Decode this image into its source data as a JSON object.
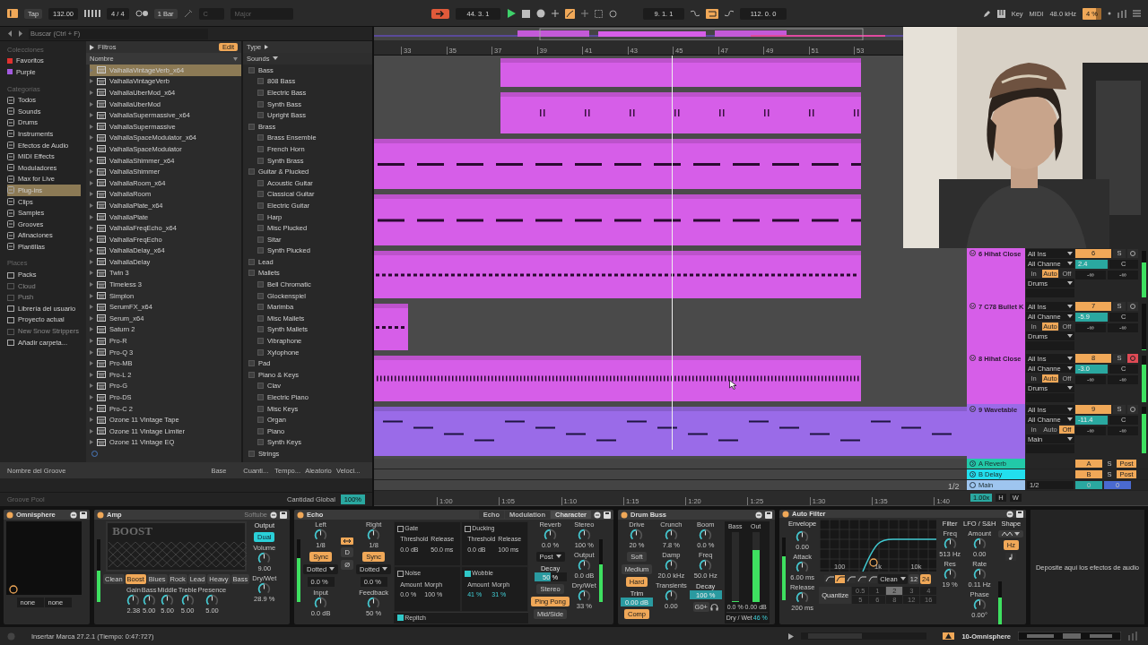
{
  "transport": {
    "tap": "Tap",
    "tempo": "132.00",
    "signature": "4 / 4",
    "quantize": "1 Bar",
    "key": "C",
    "scale": "Major",
    "position": "44. 3. 1",
    "loop_start": "9. 1. 1",
    "loop_on": true,
    "loop_length": "112. 0. 0",
    "key_map": "Key",
    "midi_map": "MIDI",
    "sample_rate": "48.0 kHz",
    "cpu": "4 %"
  },
  "browser": {
    "search_placeholder": "Buscar (Ctrl + F)",
    "collections_title": "Colecciones",
    "collections": [
      {
        "label": "Favoritos",
        "color": "#e0312f"
      },
      {
        "label": "Purple",
        "color": "#a35ae0"
      }
    ],
    "categories_title": "Categorías",
    "categories": [
      {
        "label": "Todos",
        "selected": false
      },
      {
        "label": "Sounds",
        "selected": false
      },
      {
        "label": "Drums",
        "selected": false
      },
      {
        "label": "Instruments",
        "selected": false
      },
      {
        "label": "Efectos de Audio",
        "selected": false
      },
      {
        "label": "MIDI Effects",
        "selected": false
      },
      {
        "label": "Moduladores",
        "selected": false
      },
      {
        "label": "Max for Live",
        "selected": false
      },
      {
        "label": "Plug-ins",
        "selected": true
      },
      {
        "label": "Clips",
        "selected": false
      },
      {
        "label": "Samples",
        "selected": false
      },
      {
        "label": "Grooves",
        "selected": false
      },
      {
        "label": "Afinaciones",
        "selected": false
      },
      {
        "label": "Plantillas",
        "selected": false
      }
    ],
    "places_title": "Places",
    "places": [
      {
        "label": "Packs",
        "disabled": false
      },
      {
        "label": "Cloud",
        "disabled": true
      },
      {
        "label": "Push",
        "disabled": true
      },
      {
        "label": "Librería del usuario",
        "disabled": false
      },
      {
        "label": "Proyecto actual",
        "disabled": false
      },
      {
        "label": "New Snow Strippers",
        "disabled": true
      },
      {
        "label": "Añadir carpeta...",
        "disabled": false
      }
    ],
    "filters": "Filtros",
    "edit": "Edit",
    "name_header": "Nombre",
    "files": [
      {
        "label": "ValhallaVintageVerb_x64",
        "selected": true
      },
      {
        "label": "ValhallaVintageVerb",
        "selected": false
      },
      {
        "label": "ValhallaUberMod_x64",
        "selected": false
      },
      {
        "label": "ValhallaUberMod",
        "selected": false
      },
      {
        "label": "ValhallaSupermassive_x64",
        "selected": false
      },
      {
        "label": "ValhallaSupermassive",
        "selected": false
      },
      {
        "label": "ValhallaSpaceModulator_x64",
        "selected": false
      },
      {
        "label": "ValhallaSpaceModulator",
        "selected": false
      },
      {
        "label": "ValhallaShimmer_x64",
        "selected": false
      },
      {
        "label": "ValhallaShimmer",
        "selected": false
      },
      {
        "label": "ValhallaRoom_x64",
        "selected": false
      },
      {
        "label": "ValhallaRoom",
        "selected": false
      },
      {
        "label": "ValhallaPlate_x64",
        "selected": false
      },
      {
        "label": "ValhallaPlate",
        "selected": false
      },
      {
        "label": "ValhallaFreqEcho_x64",
        "selected": false
      },
      {
        "label": "ValhallaFreqEcho",
        "selected": false
      },
      {
        "label": "ValhallaDelay_x64",
        "selected": false
      },
      {
        "label": "ValhallaDelay",
        "selected": false
      },
      {
        "label": "Twin 3",
        "selected": false
      },
      {
        "label": "Timeless 3",
        "selected": false
      },
      {
        "label": "Simplon",
        "selected": false
      },
      {
        "label": "SerumFX_x64",
        "selected": false
      },
      {
        "label": "Serum_x64",
        "selected": false
      },
      {
        "label": "Saturn 2",
        "selected": false
      },
      {
        "label": "Pro-R",
        "selected": false
      },
      {
        "label": "Pro-Q 3",
        "selected": false
      },
      {
        "label": "Pro-MB",
        "selected": false
      },
      {
        "label": "Pro-L 2",
        "selected": false
      },
      {
        "label": "Pro-G",
        "selected": false
      },
      {
        "label": "Pro-DS",
        "selected": false
      },
      {
        "label": "Pro-C 2",
        "selected": false
      },
      {
        "label": "Ozone 11 Vintage Tape",
        "selected": false
      },
      {
        "label": "Ozone 11 Vintage Limiter",
        "selected": false
      },
      {
        "label": "Ozone 11 Vintage EQ",
        "selected": false
      }
    ],
    "type_header": "Type",
    "type_filter": "Sounds",
    "types": [
      {
        "label": "Bass",
        "checked": false,
        "children": [
          {
            "label": "808 Bass",
            "checked": false
          },
          {
            "label": "Electric Bass",
            "checked": false
          },
          {
            "label": "Synth Bass",
            "checked": false
          },
          {
            "label": "Upright Bass",
            "checked": false
          }
        ]
      },
      {
        "label": "Brass",
        "checked": false,
        "children": [
          {
            "label": "Brass Ensemble",
            "checked": false
          },
          {
            "label": "French Horn",
            "checked": false
          },
          {
            "label": "Synth Brass",
            "checked": false
          }
        ]
      },
      {
        "label": "Guitar & Plucked",
        "checked": false,
        "children": [
          {
            "label": "Acoustic Guitar",
            "checked": false
          },
          {
            "label": "Classical Guitar",
            "checked": false
          },
          {
            "label": "Electric Guitar",
            "checked": false
          },
          {
            "label": "Harp",
            "checked": false
          },
          {
            "label": "Misc Plucked",
            "checked": false
          },
          {
            "label": "Sitar",
            "checked": false
          },
          {
            "label": "Synth Plucked",
            "checked": false
          }
        ]
      },
      {
        "label": "Lead",
        "checked": false
      },
      {
        "label": "Mallets",
        "checked": false,
        "children": [
          {
            "label": "Bell Chromatic",
            "checked": false
          },
          {
            "label": "Glockenspiel",
            "checked": false
          },
          {
            "label": "Marimba",
            "checked": false
          },
          {
            "label": "Misc Mallets",
            "checked": false
          },
          {
            "label": "Synth Mallets",
            "checked": false
          },
          {
            "label": "Vibraphone",
            "checked": false
          },
          {
            "label": "Xylophone",
            "checked": false
          }
        ]
      },
      {
        "label": "Pad",
        "checked": false
      },
      {
        "label": "Piano & Keys",
        "checked": false,
        "children": [
          {
            "label": "Clav",
            "checked": false
          },
          {
            "label": "Electric Piano",
            "checked": false
          },
          {
            "label": "Misc Keys",
            "checked": false
          },
          {
            "label": "Organ",
            "checked": false
          },
          {
            "label": "Piano",
            "checked": false
          },
          {
            "label": "Synth Keys",
            "checked": false
          }
        ]
      },
      {
        "label": "Strings",
        "checked": false
      }
    ],
    "groove": {
      "columns": [
        "Nombre del Groove",
        "Base",
        "Cuanti...",
        "Tempo...",
        "Aleatorio",
        "Veloci..."
      ],
      "title": "Groove Pool",
      "amount_label": "Cantidad Global",
      "amount": "100%"
    }
  },
  "arrangement": {
    "bars": [
      "33",
      "35",
      "37",
      "39",
      "41",
      "43",
      "45",
      "47",
      "49",
      "51",
      "53"
    ],
    "tracks": [
      {
        "color": "#d65ee8"
      },
      {
        "color": "#d65ee8"
      },
      {
        "color": "#d65ee8"
      },
      {
        "color": "#d65ee8"
      },
      {
        "color": "#d65ee8",
        "mixer": {
          "name": "6 Hihat Close",
          "input": "All Ins",
          "channel": "All Channe",
          "monitor": [
            {
              "label": "In",
              "selected": false
            },
            {
              "label": "Auto",
              "selected": true
            },
            {
              "label": "Off",
              "selected": false
            }
          ],
          "output": "Drums",
          "number": "6",
          "on": true,
          "solo_label": "S",
          "solo": false,
          "armed": false,
          "volume": "2.4",
          "pan": "C",
          "sends": [
            "-∞",
            "-∞"
          ],
          "meter": {
            "level": 0.75
          }
        }
      },
      {
        "color": "#d65ee8",
        "mixer": {
          "name": "7 C78 Bullet K",
          "input": "All Ins",
          "channel": "All Channe",
          "monitor": [
            {
              "label": "In",
              "selected": false
            },
            {
              "label": "Auto",
              "selected": true
            },
            {
              "label": "Off",
              "selected": false
            }
          ],
          "output": "Drums",
          "number": "7",
          "on": true,
          "solo_label": "S",
          "solo": false,
          "armed": false,
          "volume": "-5.9",
          "pan": "C",
          "sends": [
            "-∞",
            "-∞"
          ],
          "meter": {
            "level": 0
          }
        }
      },
      {
        "color": "#d65ee8",
        "mixer": {
          "name": "8 Hihat Close",
          "input": "All Ins",
          "channel": "All Channe",
          "monitor": [
            {
              "label": "In",
              "selected": false
            },
            {
              "label": "Auto",
              "selected": true
            },
            {
              "label": "Off",
              "selected": false
            }
          ],
          "output": "Drums",
          "number": "8",
          "on": true,
          "solo_label": "S",
          "solo": false,
          "armed": true,
          "volume": "-3.0",
          "pan": "C",
          "sends": [
            "-∞",
            "-∞"
          ],
          "meter": {
            "level": 0.8
          }
        }
      },
      {
        "color": "#9a6be8",
        "mixer": {
          "name": "9 Wavetable",
          "input": "All Ins",
          "channel": "All Channe",
          "monitor": [
            {
              "label": "In",
              "selected": false
            },
            {
              "label": "Auto",
              "selected": false
            },
            {
              "label": "Off",
              "selected": true
            }
          ],
          "output": "Main",
          "number": "9",
          "on": true,
          "solo_label": "S",
          "solo": false,
          "armed": false,
          "volume": "-11.4",
          "pan": "C",
          "sends": [
            "-∞",
            "-∞"
          ],
          "meter": {
            "level": 0.85
          }
        }
      }
    ],
    "returns": [
      {
        "name": "A Reverb",
        "color": "#22c9a8",
        "letter": "A",
        "solo_label": "S",
        "post": "Post"
      },
      {
        "name": "B Delay",
        "color": "#22dfee",
        "letter": "B",
        "solo_label": "S",
        "post": "Post"
      }
    ],
    "main": {
      "name": "Main",
      "color": "#9ec5ef",
      "output": "1/2",
      "values": [
        "0",
        "0"
      ]
    },
    "grid_label": "1/2",
    "time_ticks": [
      "1:00",
      "1:05",
      "1:10",
      "1:15",
      "1:20",
      "1:25",
      "1:30",
      "1:35",
      "1:40"
    ],
    "zoom": "1.00x",
    "h": "H",
    "w": "W"
  },
  "devices": [
    {
      "title": "Omnisphere",
      "on": true,
      "columns": [
        [
          {
            "kind": "screen"
          },
          {
            "kind": "row",
            "items": [
              {
                "kind": "field",
                "value": "none"
              },
              {
                "kind": "field",
                "value": "none"
              }
            ]
          }
        ]
      ]
    },
    {
      "title": "Amp",
      "on": true,
      "brand": "Softube",
      "columns": [
        [
          {
            "kind": "meter",
            "level": 0.5
          }
        ],
        [
          {
            "kind": "display",
            "text": "BOOST"
          },
          {
            "kind": "row",
            "items": [
              {
                "kind": "button",
                "label": "Clean",
                "selected": false
              },
              {
                "kind": "button",
                "label": "Boost",
                "selected": true
              },
              {
                "kind": "button",
                "label": "Blues",
                "selected": false
              },
              {
                "kind": "button",
                "label": "Rock",
                "selected": false
              },
              {
                "kind": "button",
                "label": "Lead",
                "selected": false
              },
              {
                "kind": "button",
                "label": "Heavy",
                "selected": false
              },
              {
                "kind": "button",
                "label": "Bass",
                "selected": false
              }
            ]
          },
          {
            "kind": "row",
            "items": [
              {
                "kind": "knob",
                "label": "Gain",
                "value": "2.38"
              },
              {
                "kind": "knob",
                "label": "Bass",
                "value": "5.00"
              },
              {
                "kind": "knob",
                "label": "Middle",
                "value": "5.00"
              },
              {
                "kind": "knob",
                "label": "Treble",
                "value": "5.00"
              },
              {
                "kind": "knob",
                "label": "Presence",
                "value": "5.00"
              }
            ]
          }
        ],
        [
          {
            "kind": "label",
            "text": "Output"
          },
          {
            "kind": "toggle",
            "label": "Dual",
            "selected": true
          },
          {
            "kind": "knob",
            "label": "Volume",
            "value": "9.00"
          },
          {
            "kind": "knob",
            "label": "Dry/Wet",
            "value": "28.9 %"
          }
        ]
      ]
    },
    {
      "title": "Echo",
      "on": true,
      "tabs": [
        {
          "label": "Echo",
          "selected": false
        },
        {
          "label": "Modulation",
          "selected": false
        },
        {
          "label": "Character",
          "selected": true
        }
      ],
      "columns": [
        [
          {
            "kind": "meter",
            "level": 0.7
          }
        ],
        [
          {
            "kind": "knob",
            "label": "Left",
            "value": "1/8"
          },
          {
            "kind": "button",
            "label": "Sync",
            "selected": true
          },
          {
            "kind": "select",
            "label": "Dotted"
          },
          {
            "kind": "field",
            "value": "0.0 %"
          },
          {
            "kind": "knob",
            "label": "Input",
            "value": "0.0 dB"
          }
        ],
        [
          {
            "kind": "link",
            "on": true
          },
          {
            "kind": "button",
            "label": "D",
            "selected": false
          },
          {
            "kind": "button",
            "label": "Ø",
            "selected": false
          }
        ],
        [
          {
            "kind": "knob",
            "label": "Right",
            "value": "1/8"
          },
          {
            "kind": "button",
            "label": "Sync",
            "selected": true
          },
          {
            "kind": "select",
            "label": "Dotted"
          },
          {
            "kind": "field",
            "value": "0.0 %"
          },
          {
            "kind": "knob",
            "label": "Feedback",
            "value": "50 %"
          }
        ],
        [
          {
            "kind": "panel",
            "sections": [
              {
                "label": "Gate",
                "checked": false,
                "params": [
                  {
                    "label": "Threshold",
                    "value": "0.0 dB"
                  },
                  {
                    "label": "Release",
                    "value": "50.0 ms"
                  }
                ]
              },
              {
                "label": "Ducking",
                "checked": false,
                "params": [
                  {
                    "label": "Threshold",
                    "value": "0.0 dB"
                  },
                  {
                    "label": "Release",
                    "value": "100 ms"
                  }
                ]
              },
              {
                "label": "Noise",
                "checked": false,
                "params": [
                  {
                    "label": "Amount",
                    "value": "0.0 %"
                  },
                  {
                    "label": "Morph",
                    "value": "100 %"
                  }
                ]
              },
              {
                "label": "Wobble",
                "checked": true,
                "params": [
                  {
                    "label": "Amount",
                    "value": "41 %"
                  },
                  {
                    "label": "Morph",
                    "value": "31 %"
                  }
                ]
              }
            ],
            "footer": {
              "label": "Repitch",
              "checked": true
            }
          }
        ],
        [
          {
            "kind": "knob",
            "label": "Reverb",
            "value": "0.0 %"
          },
          {
            "kind": "select",
            "label": "Post"
          },
          {
            "kind": "bar",
            "label": "Decay",
            "value": "50 %",
            "level": 0.5
          },
          {
            "kind": "button",
            "label": "Stereo",
            "selected": false
          },
          {
            "kind": "button",
            "label": "Ping Pong",
            "selected": true
          },
          {
            "kind": "button",
            "label": "Mid/Side",
            "selected": false
          }
        ],
        [
          {
            "kind": "knob",
            "label": "Stereo",
            "value": "100 %"
          },
          {
            "kind": "knob",
            "label": "Output",
            "value": "0.0 dB"
          },
          {
            "kind": "knob",
            "label": "Dry/Wet",
            "value": "33 %"
          }
        ],
        [
          {
            "kind": "meter",
            "level": 0.6
          }
        ]
      ]
    },
    {
      "title": "Drum Buss",
      "on": true,
      "columns": [
        [
          {
            "kind": "knob",
            "label": "Drive",
            "value": "20 %"
          },
          {
            "kind": "button",
            "label": "Soft",
            "selected": false
          },
          {
            "kind": "button",
            "label": "Medium",
            "selected": false
          },
          {
            "kind": "button",
            "label": "Hard",
            "selected": true
          },
          {
            "kind": "bar",
            "label": "Trim",
            "value": "0.00 dB",
            "level": 1
          },
          {
            "kind": "button",
            "label": "Comp",
            "selected": true
          }
        ],
        [
          {
            "kind": "knob",
            "label": "Crunch",
            "value": "7.8 %"
          },
          {
            "kind": "knob",
            "label": "Damp",
            "value": "20.0 kHz"
          },
          {
            "kind": "knob",
            "label": "Transients",
            "value": "0.00"
          }
        ],
        [
          {
            "kind": "knob",
            "label": "Boom",
            "value": "0.0 %"
          },
          {
            "kind": "knob",
            "label": "Freq",
            "value": "50.0 Hz"
          },
          {
            "kind": "bar",
            "label": "Decay",
            "value": "100 %",
            "level": 1
          },
          {
            "kind": "row",
            "items": [
              {
                "kind": "button",
                "label": "G0+",
                "selected": false
              },
              {
                "kind": "headphones-button"
              }
            ]
          }
        ],
        [
          {
            "kind": "buss-meter",
            "meters": [
              {
                "label": "Bass",
                "value": "0.0 %",
                "level": 0
              },
              {
                "label": "Out",
                "value": "0.00 dB",
                "level": 0.75
              }
            ],
            "mix_label": "Dry / Wet",
            "mix_value": "46 %"
          }
        ]
      ]
    },
    {
      "title": "Auto Filter",
      "on": true,
      "columns": [
        [
          {
            "kind": "meter",
            "level": 0.7
          }
        ],
        [
          {
            "kind": "label",
            "text": "Envelope"
          },
          {
            "kind": "knob",
            "value": "0.00"
          },
          {
            "kind": "knob",
            "label": "Attack",
            "value": "6.00 ms"
          },
          {
            "kind": "knob",
            "label": "Release",
            "value": "200 ms"
          }
        ],
        [
          {
            "kind": "filter-graph",
            "ticks": [
              "100",
              "1k",
              "10k"
            ]
          },
          {
            "kind": "row",
            "items": [
              {
                "kind": "filter-type",
                "selected": false
              },
              {
                "kind": "filter-type",
                "selected": true
              },
              {
                "kind": "filter-type",
                "selected": false
              },
              {
                "kind": "filter-type",
                "selected": false
              },
              {
                "kind": "filter-type",
                "selected": false
              },
              {
                "kind": "select",
                "label": "Clean"
              },
              {
                "kind": "button",
                "label": "12",
                "selected": false
              },
              {
                "kind": "button",
                "label": "24",
                "selected": true
              }
            ]
          },
          {
            "kind": "quantize",
            "label": "Quantize",
            "options": [
              {
                "label": "0.5",
                "selected": false
              },
              {
                "label": "1",
                "selected": false
              },
              {
                "label": "2",
                "selected": true
              },
              {
                "label": "3",
                "selected": false
              },
              {
                "label": "4",
                "selected": false
              },
              {
                "label": "5",
                "selected": false
              },
              {
                "label": "6",
                "selected": false
              },
              {
                "label": "8",
                "selected": false
              },
              {
                "label": "12",
                "selected": false
              },
              {
                "label": "16",
                "selected": false
              }
            ]
          }
        ],
        [
          {
            "kind": "label",
            "text": "Filter"
          },
          {
            "kind": "knob",
            "label": "Freq",
            "value": "513 Hz"
          },
          {
            "kind": "knob",
            "label": "Res",
            "value": "19 %"
          }
        ],
        [
          {
            "kind": "label",
            "text": "LFO / S&H"
          },
          {
            "kind": "knob",
            "label": "Amount",
            "value": "0.00"
          },
          {
            "kind": "knob",
            "label": "Rate",
            "value": "0.11 Hz"
          },
          {
            "kind": "knob",
            "label": "Phase",
            "value": "0.00°"
          }
        ],
        [
          {
            "kind": "label",
            "text": "Shape"
          },
          {
            "kind": "shape-select"
          },
          {
            "kind": "button",
            "label": "Hz",
            "selected": true
          },
          {
            "kind": "note-button"
          },
          {
            "kind": "meter",
            "level": 0.75
          }
        ]
      ]
    }
  ],
  "drop_hint": "Deposite aquí los efectos de audio",
  "status": {
    "message": "Insertar Marca 27.2.1 (Tiempo: 0:47:727)",
    "track": "10-Omnisphere"
  }
}
